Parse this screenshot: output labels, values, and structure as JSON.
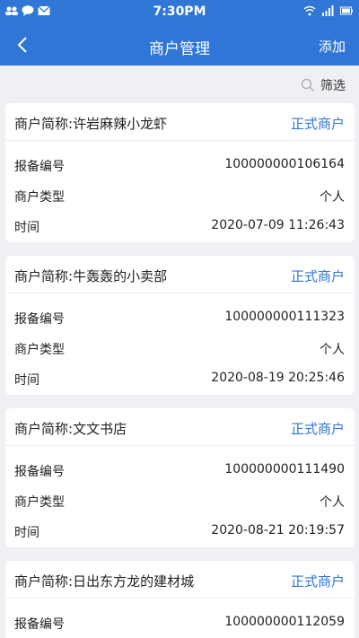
{
  "status_bar": {
    "time": "7:30PM",
    "icons": [
      "contacts-icon",
      "chat-icon",
      "mail-icon",
      "wifi-icon",
      "signal-icon",
      "battery-icon"
    ]
  },
  "nav": {
    "title": "商户管理",
    "add_label": "添加",
    "back_icon": "chevron-left-icon"
  },
  "filter": {
    "label": "筛选",
    "icon": "search-icon"
  },
  "labels": {
    "name_prefix": "商户简称:",
    "record_no": "报备编号",
    "type": "商户类型",
    "time": "时间"
  },
  "merchants": [
    {
      "name": "许岩麻辣小龙虾",
      "status": "正式商户",
      "record_no": "100000000106164",
      "type": "个人",
      "time": "2020-07-09 11:26:43"
    },
    {
      "name": "牛轰轰的小卖部",
      "status": "正式商户",
      "record_no": "100000000111323",
      "type": "个人",
      "time": "2020-08-19 20:25:46"
    },
    {
      "name": "文文书店",
      "status": "正式商户",
      "record_no": "100000000111490",
      "type": "个人",
      "time": "2020-08-21 20:19:57"
    },
    {
      "name": "日出东方龙的建材城",
      "status": "正式商户",
      "record_no": "100000000112059"
    }
  ],
  "colors": {
    "primary": "#2f76d6",
    "background": "#eef0f3"
  }
}
